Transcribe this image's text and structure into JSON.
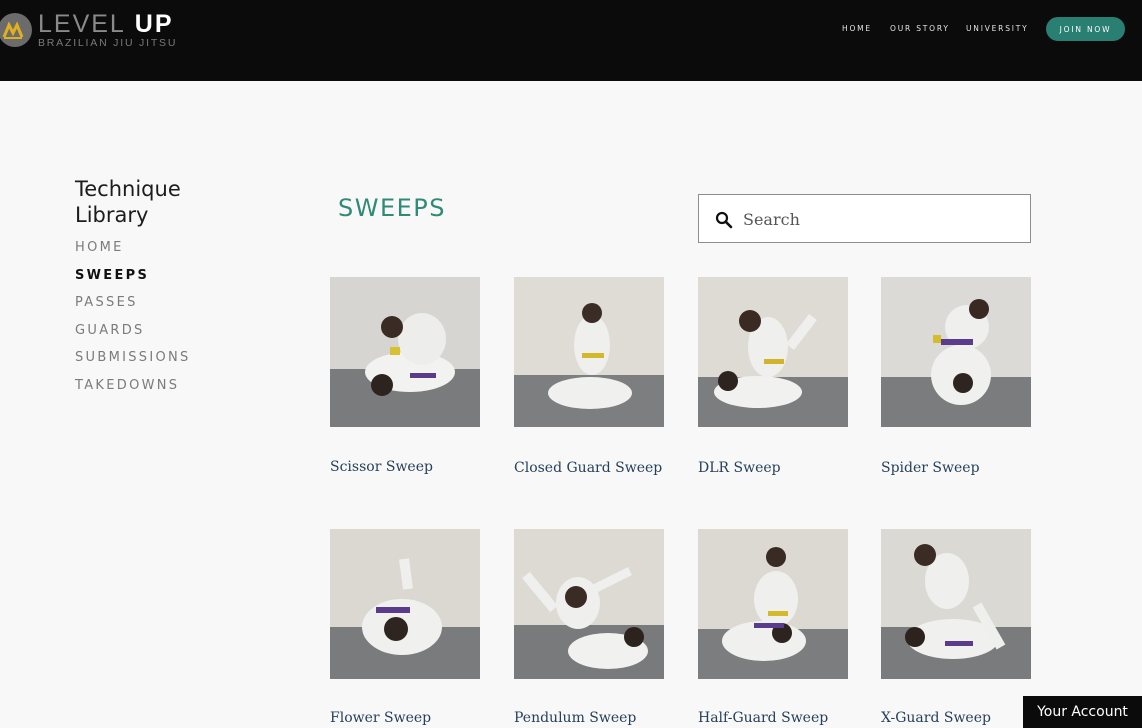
{
  "logo": {
    "main_a": "LEVEL",
    "main_b": "UP",
    "sub": "BRAZILIAN JIU JITSU"
  },
  "nav": {
    "items": [
      {
        "label": "HOME"
      },
      {
        "label": "OUR STORY"
      },
      {
        "label": "UNIVERSITY"
      }
    ],
    "cta": "JOIN NOW"
  },
  "sidebar": {
    "title": "Technique Library",
    "items": [
      {
        "label": "HOME",
        "active": false
      },
      {
        "label": "SWEEPS",
        "active": true
      },
      {
        "label": "PASSES",
        "active": false
      },
      {
        "label": "GUARDS",
        "active": false
      },
      {
        "label": "SUBMISSIONS",
        "active": false
      },
      {
        "label": "TAKEDOWNS",
        "active": false
      }
    ]
  },
  "main": {
    "title": "SWEEPS",
    "search": {
      "placeholder": "Search",
      "icon": "search-icon"
    },
    "techniques": [
      {
        "name": "Scissor Sweep"
      },
      {
        "name": "Closed Guard Sweep"
      },
      {
        "name": "DLR Sweep"
      },
      {
        "name": "Spider Sweep"
      },
      {
        "name": "Flower Sweep"
      },
      {
        "name": "Pendulum Sweep"
      },
      {
        "name": "Half-Guard Sweep"
      },
      {
        "name": "X-Guard Sweep"
      }
    ]
  },
  "account": {
    "label": "Your Account"
  },
  "colors": {
    "header_bg": "#0b0b0b",
    "accent": "#2f8a76",
    "button": "#2a7f73",
    "page_bg": "#f8f8f8",
    "caption": "#27405a"
  }
}
